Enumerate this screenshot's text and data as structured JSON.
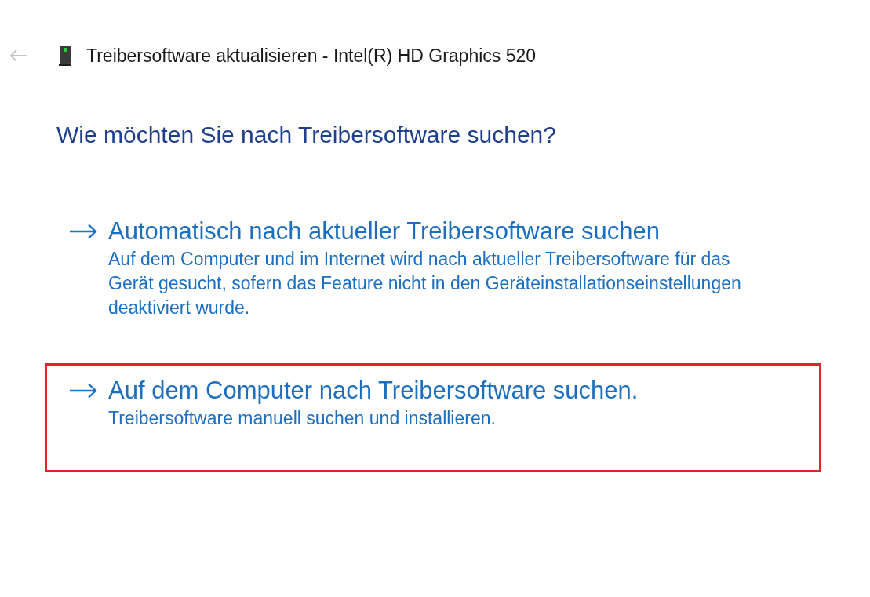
{
  "header": {
    "back_button": {
      "disabled": true
    },
    "title": "Treibersoftware aktualisieren - Intel(R) HD Graphics 520"
  },
  "question": "Wie möchten Sie nach Treibersoftware suchen?",
  "options": [
    {
      "title": "Automatisch nach aktueller Treibersoftware suchen",
      "description": "Auf dem Computer und im Internet wird nach aktueller Treibersoftware für das Gerät gesucht, sofern das Feature nicht in den Geräteinstallationseinstellungen deaktiviert wurde.",
      "highlighted": false
    },
    {
      "title": "Auf dem Computer nach Treibersoftware suchen.",
      "description": "Treibersoftware manuell suchen und installieren.",
      "highlighted": true
    }
  ]
}
